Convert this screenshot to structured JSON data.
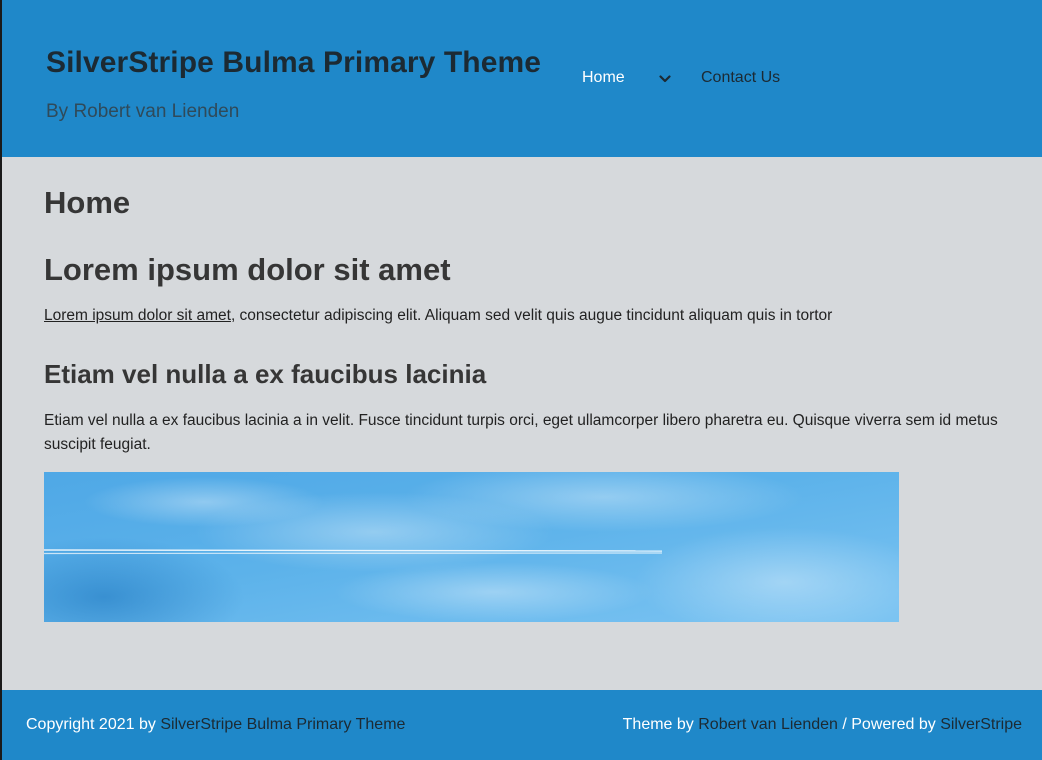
{
  "header": {
    "site_title": "SilverStripe Bulma Primary Theme",
    "site_subtitle": "By Robert van Lienden"
  },
  "nav": {
    "home_label": "Home",
    "dropdown_icon": "chevron-down-icon",
    "contact_label": "Contact Us"
  },
  "main": {
    "page_title": "Home",
    "heading_1": "Lorem ipsum dolor sit amet",
    "paragraph_1_link": "Lorem ipsum dolor sit amet",
    "paragraph_1_rest": ", consectetur adipiscing elit. Aliquam sed velit quis augue tincidunt aliquam quis in tortor",
    "heading_2": "Etiam vel nulla a ex faucibus lacinia",
    "paragraph_2": "Etiam vel nulla a ex faucibus lacinia a in velit. Fusce tincidunt turpis orci, eget ullamcorper libero pharetra eu. Quisque viverra sem id metus suscipit feugiat."
  },
  "footer": {
    "copyright_prefix": "Copyright 2021 by ",
    "copyright_link": "SilverStripe Bulma Primary Theme",
    "theme_prefix": "Theme by ",
    "theme_link": "Robert van Lienden",
    "powered_prefix": " / Powered by ",
    "powered_link": "SilverStripe"
  },
  "colors": {
    "brand_blue": "#1f88c9",
    "body_bg": "#d6d9dc",
    "dark_text": "#1c2a33"
  }
}
